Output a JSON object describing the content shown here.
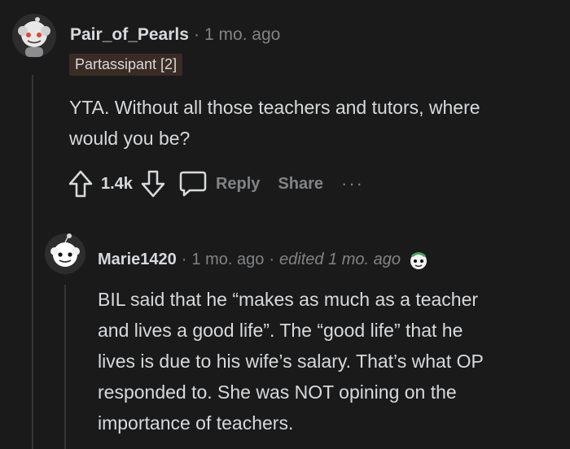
{
  "comment1": {
    "username": "Pair_of_Pearls",
    "separator": "·",
    "time": "1 mo. ago",
    "flair": "Partassipant [2]",
    "body_lines": [
      "YTA. Without all those teachers and tutors, where",
      "would you be?"
    ],
    "score": "1.4k",
    "reply_label": "Reply",
    "share_label": "Share",
    "more_label": "···"
  },
  "comment2": {
    "username": "Marie1420",
    "separator": "·",
    "time": "1 mo. ago",
    "separator2": "·",
    "edited": "edited 1 mo. ago",
    "body_lines": [
      "BIL said that he “makes as much as a teacher",
      "and lives a good life”. The “good life” that he",
      "lives is due to his wife’s salary. That’s what OP",
      "responded to. She was NOT opining on the",
      "importance of teachers."
    ]
  }
}
